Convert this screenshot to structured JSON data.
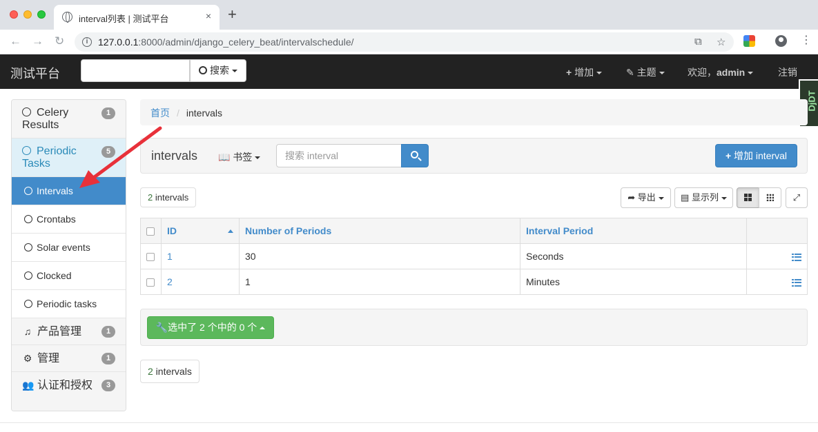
{
  "browser": {
    "tab_title": "interval列表 | 测试平台",
    "tab_close": "×",
    "new_tab": "+",
    "url_host": "127.0.0.1",
    "url_rest": ":8000/admin/django_celery_beat/intervalschedule/",
    "back": "←",
    "forward": "→",
    "reload": "↻",
    "translate_icon": "⧉",
    "star_icon": "☆",
    "menu": "⋮"
  },
  "navbar": {
    "brand": "测试平台",
    "search_button": "搜索",
    "add": "增加",
    "theme": "主题",
    "welcome": "欢迎，",
    "user": "admin",
    "logout": "注销"
  },
  "debug_badge": "DjDT",
  "sidebar": {
    "groups": [
      {
        "label": "Celery Results",
        "badge": "1"
      },
      {
        "label": "Periodic Tasks",
        "badge": "5",
        "children": [
          "Intervals",
          "Crontabs",
          "Solar events",
          "Clocked",
          "Periodic tasks"
        ]
      },
      {
        "label": "产品管理",
        "badge": "1",
        "icon": "music-icon"
      },
      {
        "label": "管理",
        "badge": "1",
        "icon": "cog-icon"
      },
      {
        "label": "认证和授权",
        "badge": "3",
        "icon": "users-icon"
      }
    ]
  },
  "breadcrumb": {
    "home": "首页",
    "sep": "/",
    "current": "intervals"
  },
  "header": {
    "title": "intervals",
    "bookmark": "书签",
    "search_placeholder": "搜索 interval",
    "add_button": "增加 interval"
  },
  "toolbar": {
    "count_number": "2",
    "count_label": " intervals",
    "export": "导出",
    "columns": "显示列"
  },
  "table": {
    "headers": [
      "ID",
      "Number of Periods",
      "Interval Period"
    ],
    "rows": [
      {
        "id": "1",
        "periods": "30",
        "period": "Seconds"
      },
      {
        "id": "2",
        "periods": "1",
        "period": "Minutes"
      }
    ]
  },
  "actions": {
    "selected_label": "选中了 2 个中的 0 个"
  },
  "footer": {
    "count_number": "2",
    "count_label": " intervals"
  },
  "colors": {
    "primary": "#428bca",
    "success": "#5cb85c",
    "navbar": "#222222",
    "annotation": "#e8313a"
  }
}
